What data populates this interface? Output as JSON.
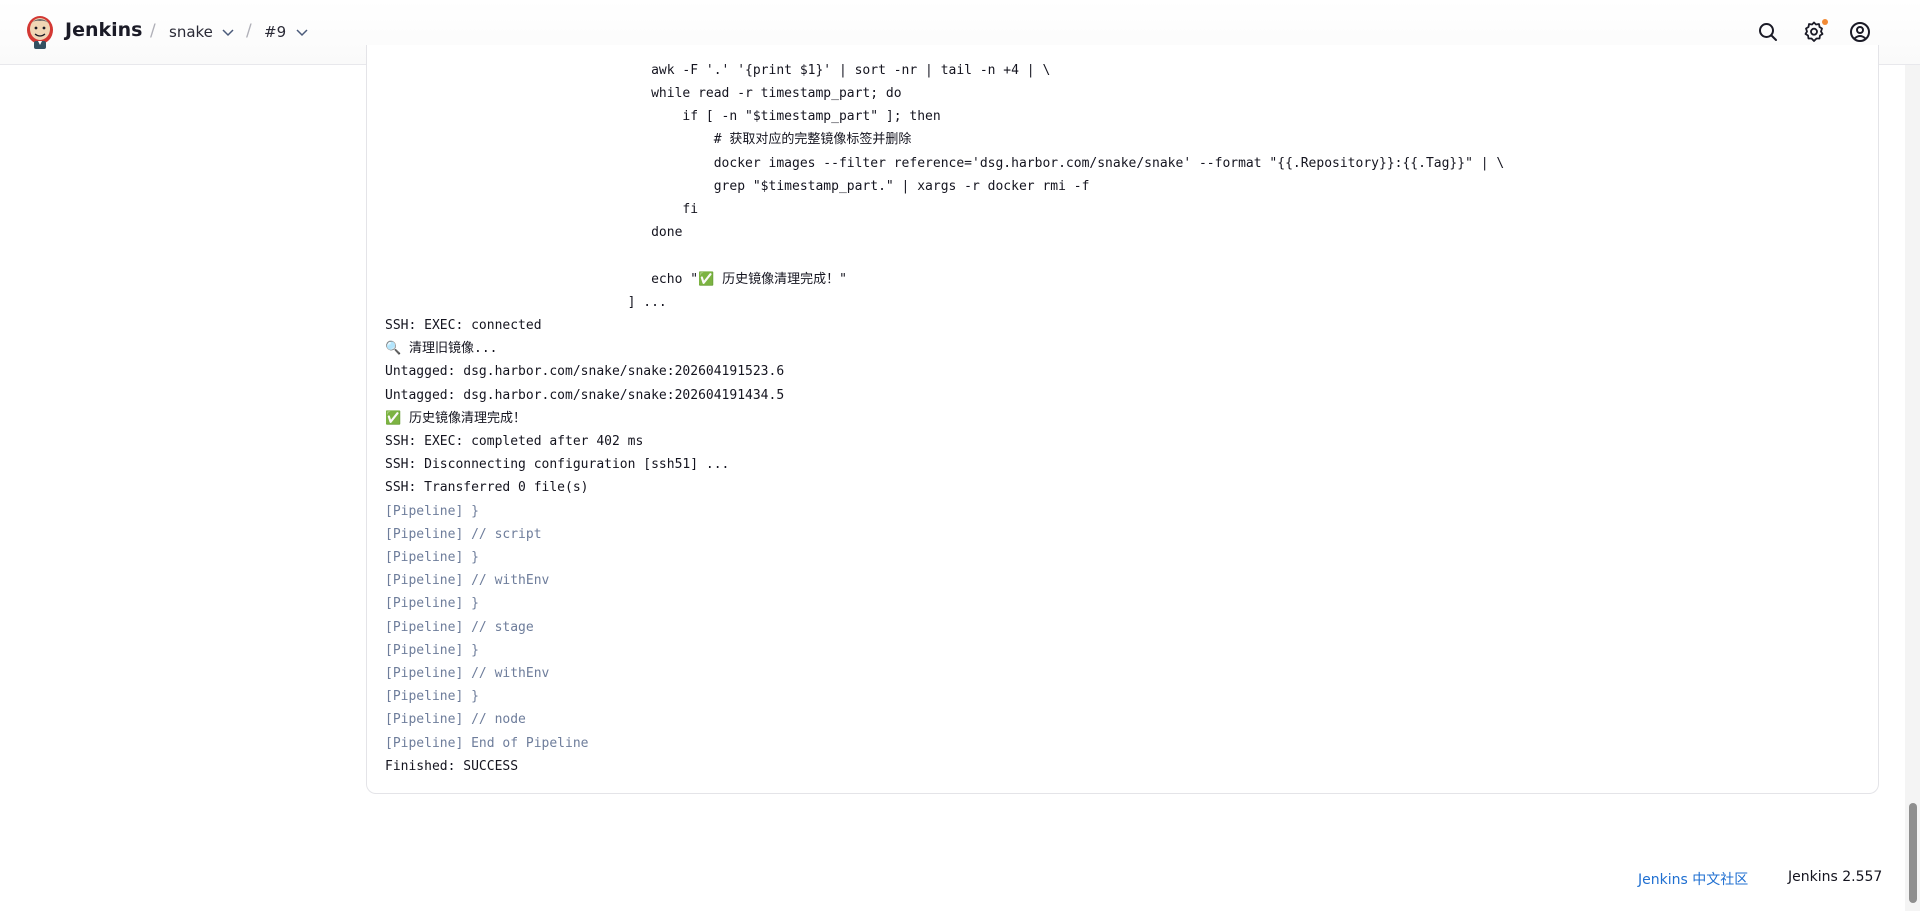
{
  "header": {
    "brand": "Jenkins",
    "breadcrumbs": [
      "snake",
      "#9"
    ],
    "separator": "/"
  },
  "console": {
    "lines": [
      {
        "text": "                                  awk -F '.' '{print $1}' | sort -nr | tail -n +4 | \\",
        "style": "normal"
      },
      {
        "text": "                                  while read -r timestamp_part; do",
        "style": "normal"
      },
      {
        "text": "                                      if [ -n \"$timestamp_part\" ]; then",
        "style": "normal"
      },
      {
        "text": "                                          # 获取对应的完整镜像标签并删除",
        "style": "normal"
      },
      {
        "text": "                                          docker images --filter reference='dsg.harbor.com/snake/snake' --format \"{{.Repository}}:{{.Tag}}\" | \\",
        "style": "normal"
      },
      {
        "text": "                                          grep \"$timestamp_part.\" | xargs -r docker rmi -f",
        "style": "normal"
      },
      {
        "text": "                                      fi",
        "style": "normal"
      },
      {
        "text": "                                  done",
        "style": "normal"
      },
      {
        "text": "",
        "style": "normal"
      },
      {
        "text": "                                  echo \"✅ 历史镜像清理完成！\"",
        "style": "normal"
      },
      {
        "text": "                               ] ...",
        "style": "normal"
      },
      {
        "text": "SSH: EXEC: connected",
        "style": "normal"
      },
      {
        "text": "🔍 清理旧镜像...",
        "style": "normal"
      },
      {
        "text": "Untagged: dsg.harbor.com/snake/snake:202604191523.6",
        "style": "normal"
      },
      {
        "text": "Untagged: dsg.harbor.com/snake/snake:202604191434.5",
        "style": "normal"
      },
      {
        "text": "✅ 历史镜像清理完成！",
        "style": "normal"
      },
      {
        "text": "SSH: EXEC: completed after 402 ms",
        "style": "normal"
      },
      {
        "text": "SSH: Disconnecting configuration [ssh51] ...",
        "style": "normal"
      },
      {
        "text": "SSH: Transferred 0 file(s)",
        "style": "normal"
      },
      {
        "text": "[Pipeline] }",
        "style": "dim"
      },
      {
        "text": "[Pipeline] // script",
        "style": "dim"
      },
      {
        "text": "[Pipeline] }",
        "style": "dim"
      },
      {
        "text": "[Pipeline] // withEnv",
        "style": "dim"
      },
      {
        "text": "[Pipeline] }",
        "style": "dim"
      },
      {
        "text": "[Pipeline] // stage",
        "style": "dim"
      },
      {
        "text": "[Pipeline] }",
        "style": "dim"
      },
      {
        "text": "[Pipeline] // withEnv",
        "style": "dim"
      },
      {
        "text": "[Pipeline] }",
        "style": "dim"
      },
      {
        "text": "[Pipeline] // node",
        "style": "dim"
      },
      {
        "text": "[Pipeline] End of Pipeline",
        "style": "dim"
      },
      {
        "text": "Finished: SUCCESS",
        "style": "normal"
      }
    ]
  },
  "footer": {
    "community_link": "Jenkins 中文社区",
    "version": "Jenkins 2.557"
  },
  "colors": {
    "accent_link": "#1f6fd1",
    "pipeline_dim": "#6e7d9b",
    "notification_dot": "#f28a34"
  }
}
